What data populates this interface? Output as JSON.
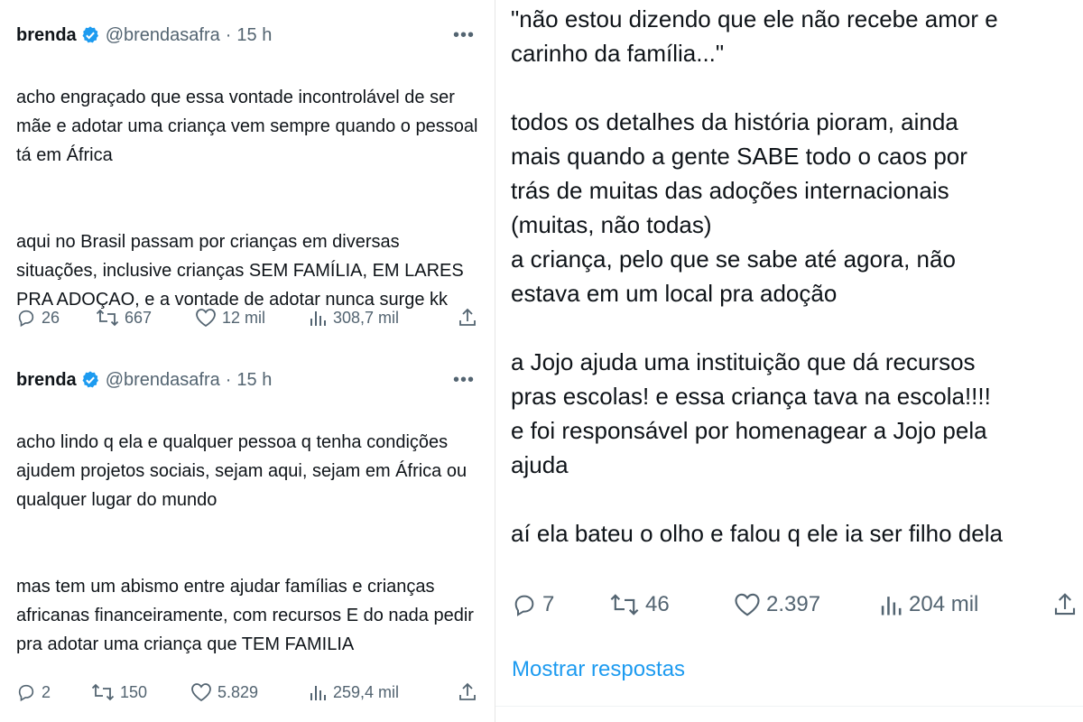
{
  "tweets": [
    {
      "author": "brenda",
      "handle": "@brendasafra",
      "time": "15 h",
      "paragraphs": [
        "acho engraçado que essa vontade incontrolável de ser mãe e adotar uma criança vem sempre quando o pessoal tá em África",
        "aqui no Brasil passam por crianças em diversas situações, inclusive crianças SEM FAMÍLIA, EM LARES PRA ADOÇAO, e a vontade de adotar nunca surge kk"
      ],
      "stats": {
        "replies": "26",
        "retweets": "667",
        "likes": "12 mil",
        "views": "308,7 mil"
      }
    },
    {
      "author": "brenda",
      "handle": "@brendasafra",
      "time": "15 h",
      "paragraphs": [
        "acho lindo q ela e qualquer pessoa q tenha condições ajudem projetos sociais, sejam aqui, sejam em África ou qualquer lugar do mundo",
        "mas tem um abismo entre ajudar famílias e crianças africanas financeiramente, com recursos E do nada pedir pra adotar uma criança que TEM FAMILIA"
      ],
      "stats": {
        "replies": "2",
        "retweets": "150",
        "likes": "5.829",
        "views": "259,4 mil"
      }
    }
  ],
  "right_tweet": {
    "lines": [
      "\"não estou dizendo que ele não recebe amor e",
      "carinho da família...\"",
      "",
      "todos os detalhes da história pioram, ainda",
      "mais quando a gente SABE todo o caos por",
      "trás de muitas das adoções internacionais",
      "(muitas, não todas)",
      "a criança, pelo que se sabe até agora, não",
      "estava em um local pra adoção",
      "",
      "a Jojo ajuda uma instituição que dá recursos",
      "pras escolas! e essa criança tava na escola!!!!",
      "e foi responsável por homenagear a Jojo pela",
      "ajuda",
      "",
      "aí ela bateu o olho e falou q ele ia ser filho dela"
    ],
    "stats": {
      "replies": "7",
      "retweets": "46",
      "likes": "2.397",
      "views": "204 mil"
    },
    "show_replies": "Mostrar respostas"
  },
  "colors": {
    "accent": "#1d9bf0",
    "secondary_text": "#536471",
    "text": "#0f1419"
  },
  "icons": [
    "verified-icon",
    "more-icon",
    "reply-icon",
    "retweet-icon",
    "like-icon",
    "views-icon",
    "share-icon"
  ]
}
